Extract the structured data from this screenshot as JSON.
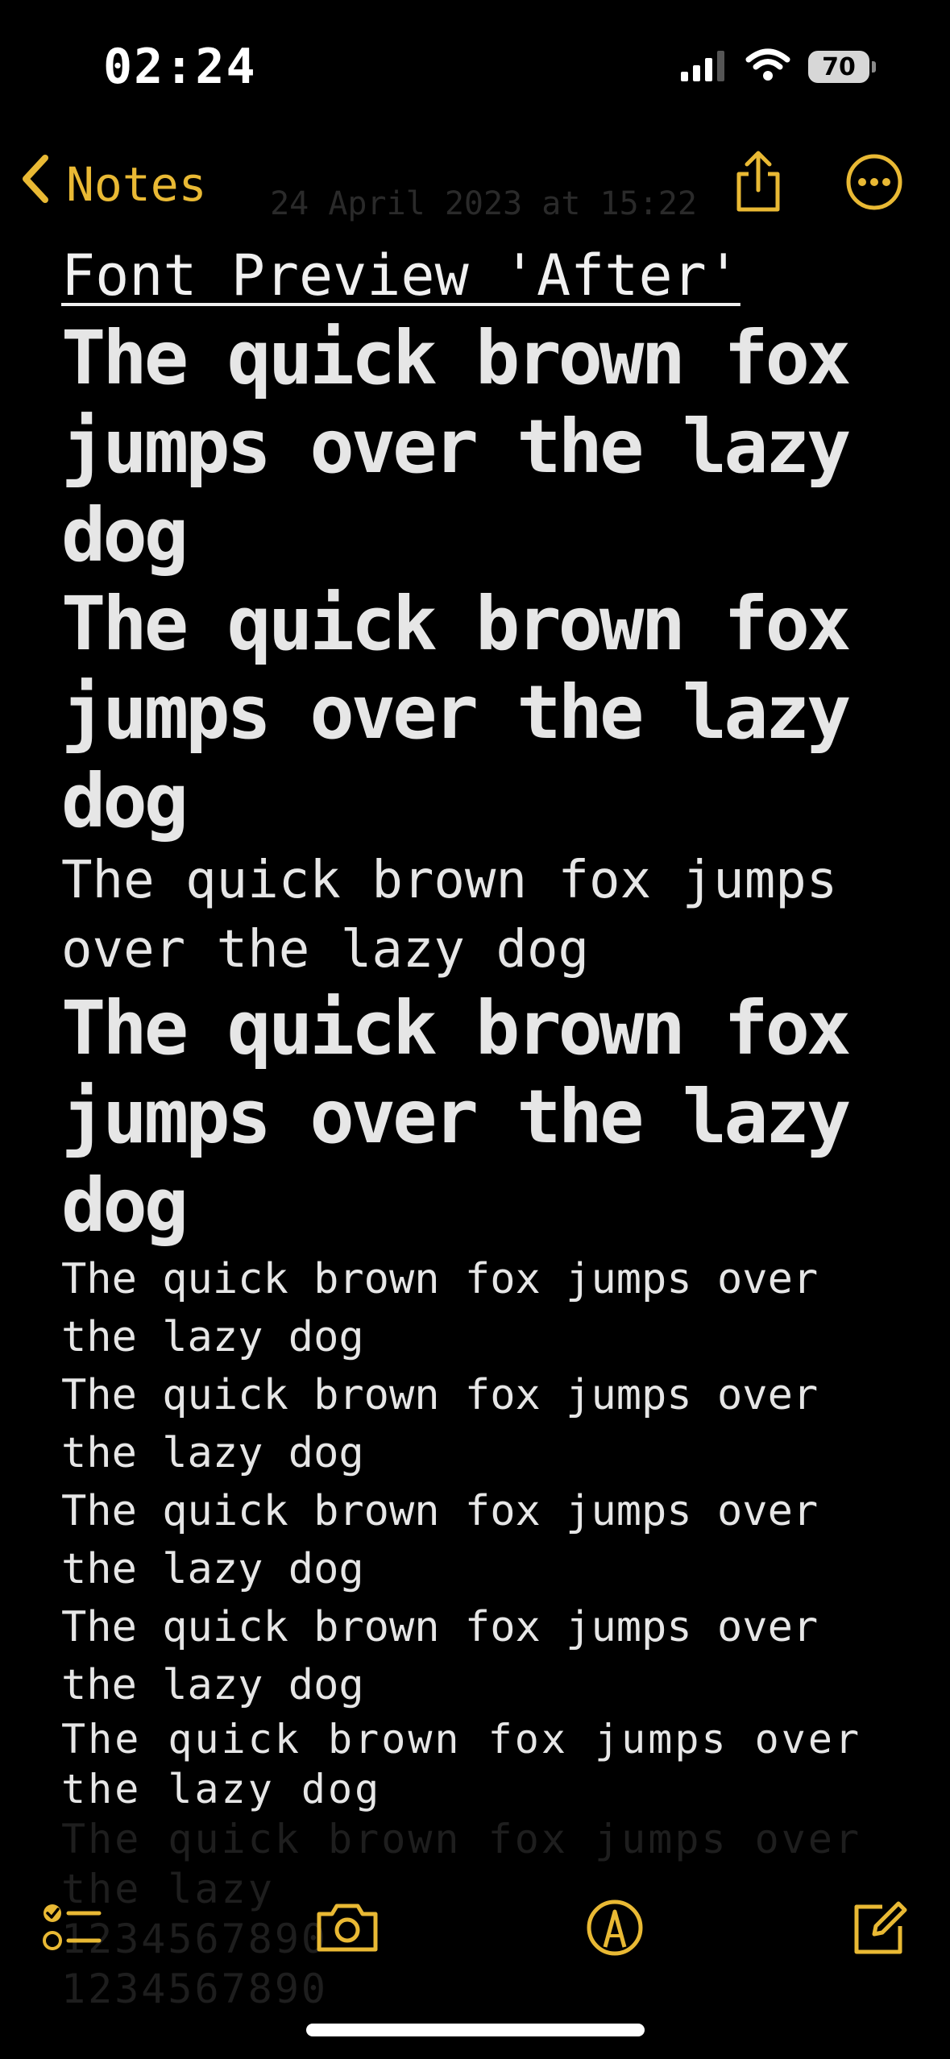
{
  "status": {
    "time": "02:24",
    "battery": "70",
    "icons": [
      "cellular-signal-icon",
      "wifi-icon",
      "battery-icon"
    ]
  },
  "nav": {
    "back_label": "Notes",
    "ghost_date": "24 April 2023 at 15:22",
    "accent": "#e9b934",
    "icons": [
      "chevron-left-icon",
      "share-icon",
      "more-icon"
    ]
  },
  "note": {
    "title": "Font Preview 'After'",
    "lines": [
      "The quick brown fox jumps over the lazy dog",
      "The quick brown fox jumps over the lazy dog",
      "The quick brown fox jumps over the lazy dog",
      "The quick brown fox jumps over the lazy dog",
      "The quick brown fox jumps over the lazy dog",
      "The quick brown fox jumps over the lazy dog",
      "The quick brown fox jumps over the lazy dog",
      "The quick brown fox jumps over the lazy dog",
      "The quick brown fox jumps over the lazy dog"
    ],
    "faded_lines": [
      "The quick brown fox jumps over",
      "the lazy",
      "1234567890",
      "1234567890"
    ]
  },
  "toolbar": {
    "icons": [
      "checklist-icon",
      "camera-icon",
      "markup-icon",
      "compose-icon"
    ]
  }
}
